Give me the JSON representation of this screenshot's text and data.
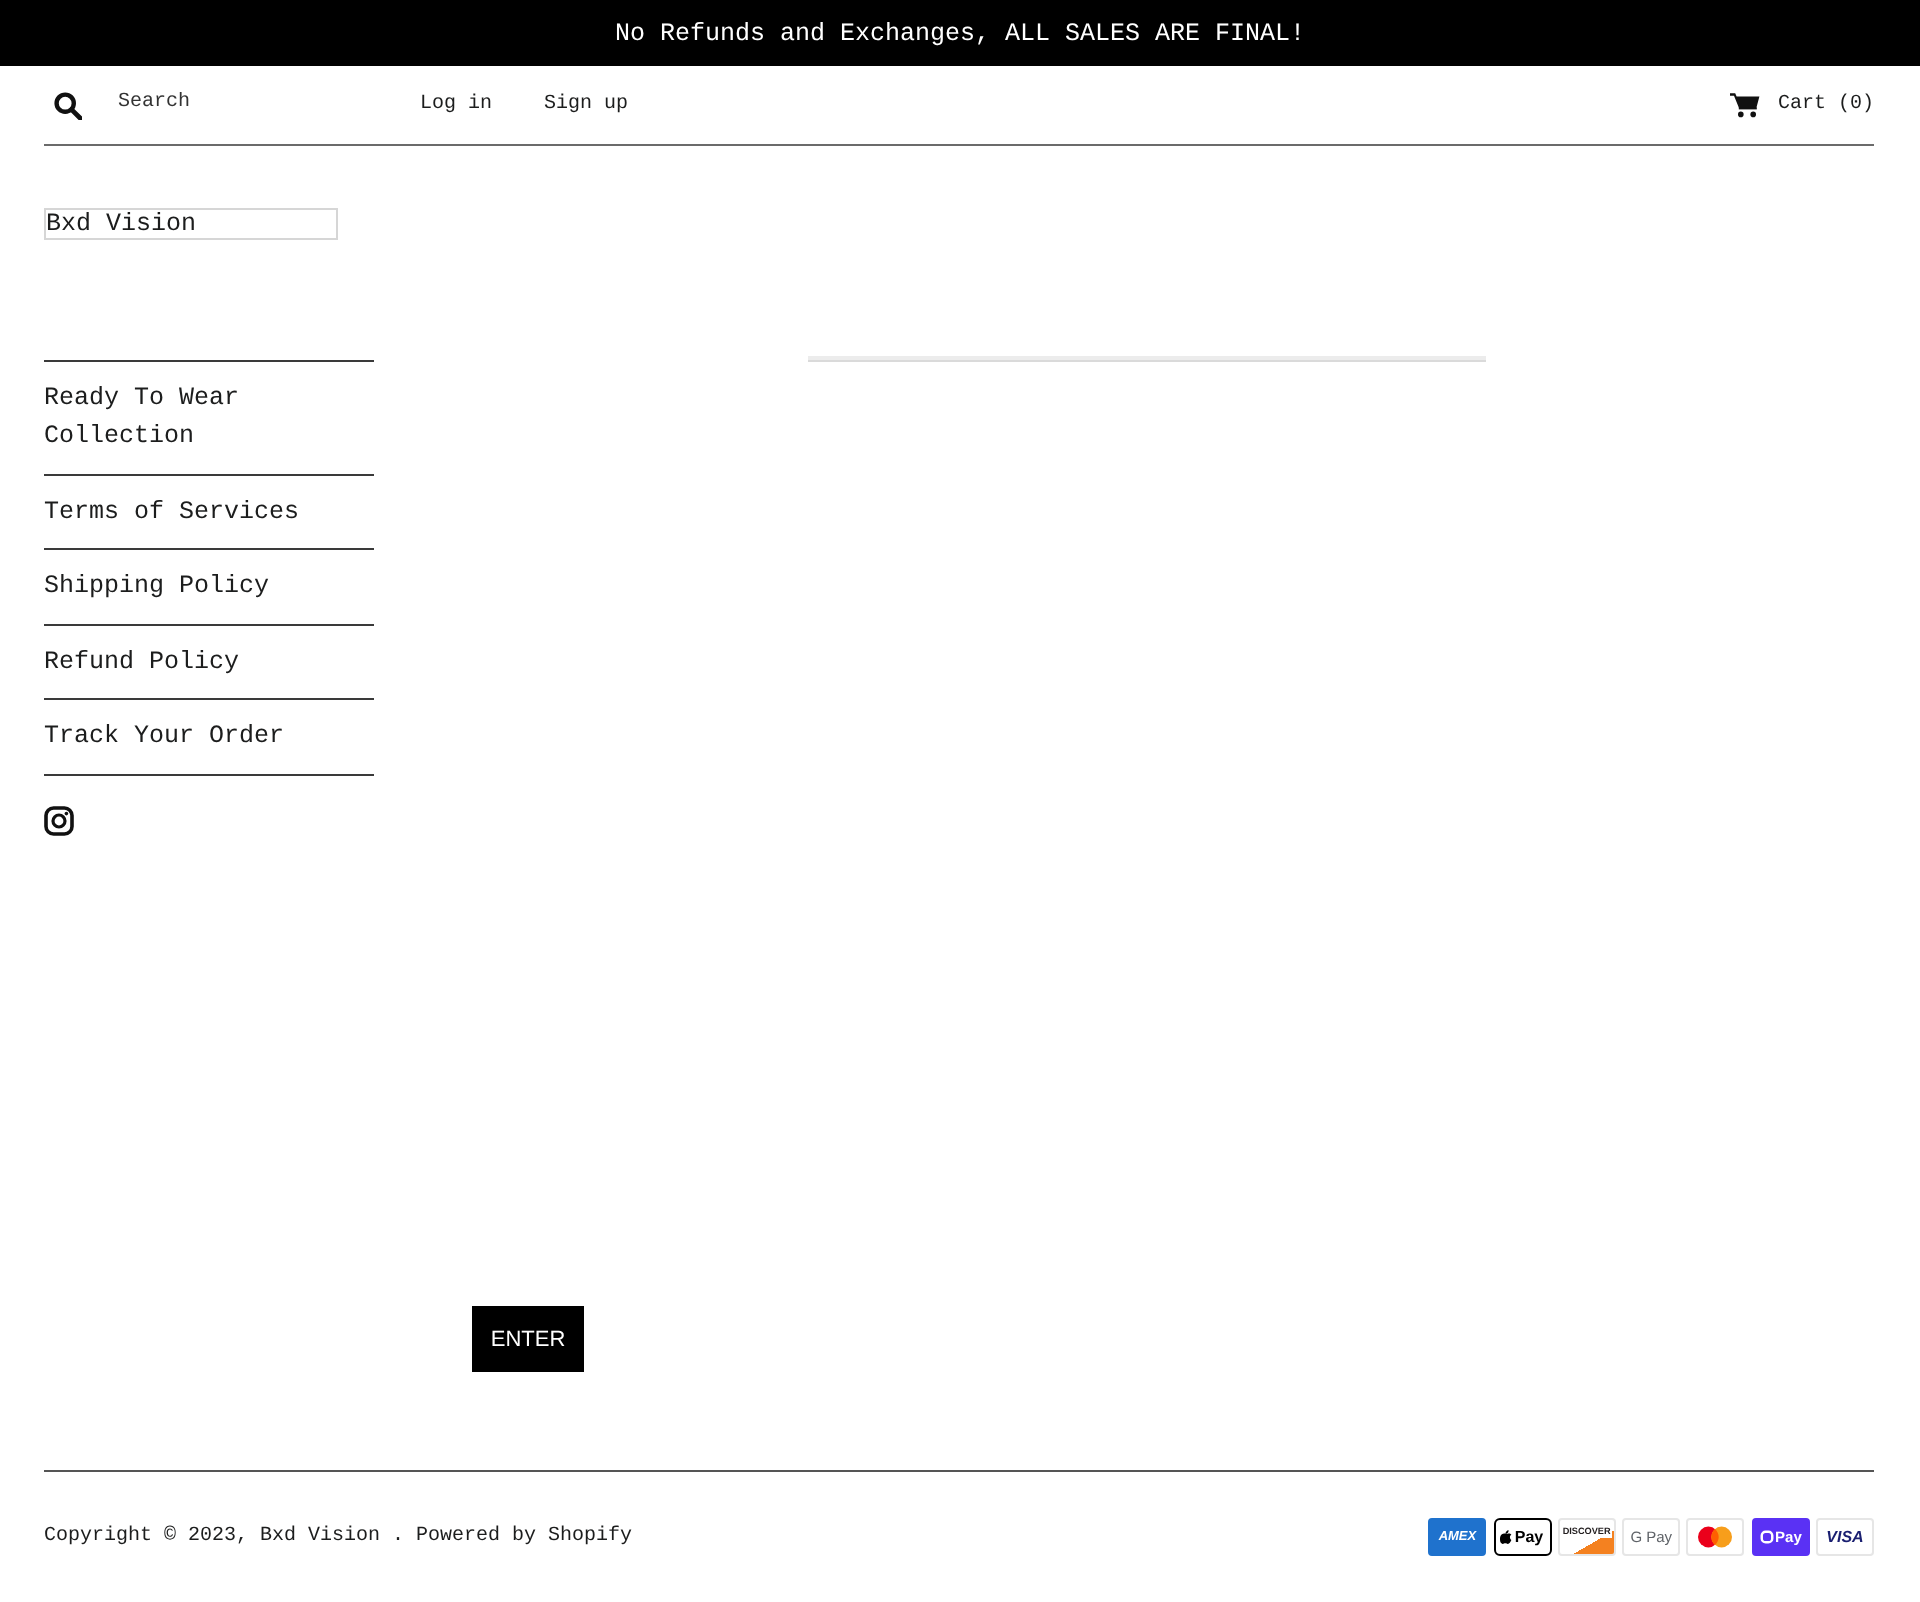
{
  "announcement": "No Refunds and Exchanges, ALL SALES ARE FINAL!",
  "header": {
    "search": {
      "placeholder": "Search"
    },
    "account_links": [
      "Log in",
      "Sign up"
    ],
    "cart": "Cart (0)"
  },
  "logo": "Bxd Vision",
  "sidebar": {
    "items": [
      {
        "label": "Ready To Wear Collection"
      },
      {
        "label": "Terms of Services"
      },
      {
        "label": "Shipping Policy"
      },
      {
        "label": "Refund Policy"
      },
      {
        "label": "Track Your Order"
      }
    ]
  },
  "main": {
    "button": "ENTER"
  },
  "footer": {
    "copyright": "Copyright © 2023, Bxd Vision . Powered by Shopify",
    "payment_methods": [
      {
        "kind": "amex",
        "label": "AMEX"
      },
      {
        "kind": "applepay",
        "label": "Pay"
      },
      {
        "kind": "discover",
        "label": "DISCOVER"
      },
      {
        "kind": "gpay",
        "label": "G Pay"
      },
      {
        "kind": "mastercard"
      },
      {
        "kind": "shoppay",
        "label": "Pay"
      },
      {
        "kind": "visa",
        "label": "VISA"
      }
    ]
  }
}
